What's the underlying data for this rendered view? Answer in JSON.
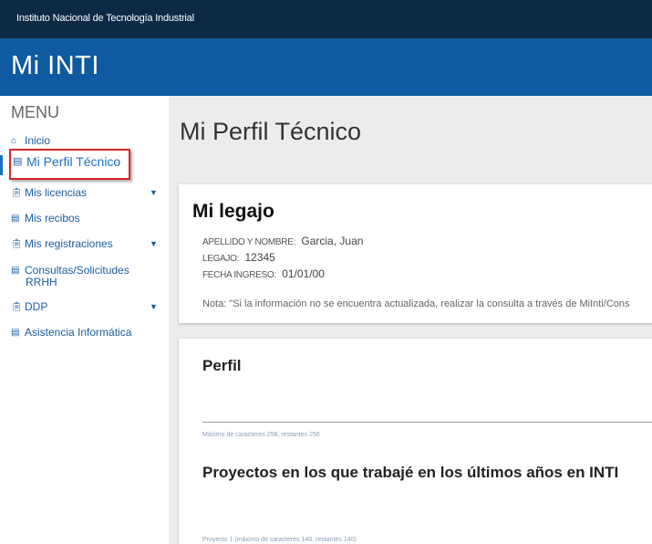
{
  "header": {
    "org_name": "Instituto Nacional de Tecnología Industrial",
    "app_title": "Mi INTI"
  },
  "sidebar": {
    "menu_title": "MENU",
    "items": [
      {
        "label": "Inicio",
        "icon": "home-icon"
      },
      {
        "label": "Mi Perfil Técnico",
        "icon": "card-icon"
      },
      {
        "label": "Mis licencias",
        "icon": "clipboard-icon",
        "has_dropdown": true
      },
      {
        "label": "Mis recibos",
        "icon": "card-icon"
      },
      {
        "label": "Mis registraciones",
        "icon": "clipboard-icon",
        "has_dropdown": true
      },
      {
        "label": "Consultas/Solicitudes",
        "label2": "RRHH",
        "icon": "card-icon"
      },
      {
        "label": "DDP",
        "icon": "clipboard-icon",
        "has_dropdown": true
      },
      {
        "label": "Asistencia Informática",
        "icon": "card-icon"
      }
    ]
  },
  "main": {
    "page_title": "Mi Perfil Técnico",
    "legajo": {
      "title": "Mi legajo",
      "fields": [
        {
          "label": "APELLIDO Y NOMBRE:",
          "value": "Garcia, Juan"
        },
        {
          "label": "LEGAJO:",
          "value": "12345"
        },
        {
          "label": "FECHA INGRESO:",
          "value": "01/01/00"
        }
      ],
      "note_label": "Nota:",
      "note_text": "\"Si la información no se encuentra actualizada, realizar la consulta a través de MiInti/Cons"
    },
    "perfil": {
      "title": "Perfil",
      "hint": "Máximo de caracteres 256, restantes 256",
      "projects_title": "Proyectos en los que trabajé en los últimos años en INTI",
      "projects_hint": "Proyecto 1 (máximo de caracteres 140, restantes 140)"
    }
  },
  "colors": {
    "topbar": "#0d2a45",
    "brandbar": "#0f5aa0",
    "link": "#1a5da0",
    "highlight_border": "#d62626"
  }
}
